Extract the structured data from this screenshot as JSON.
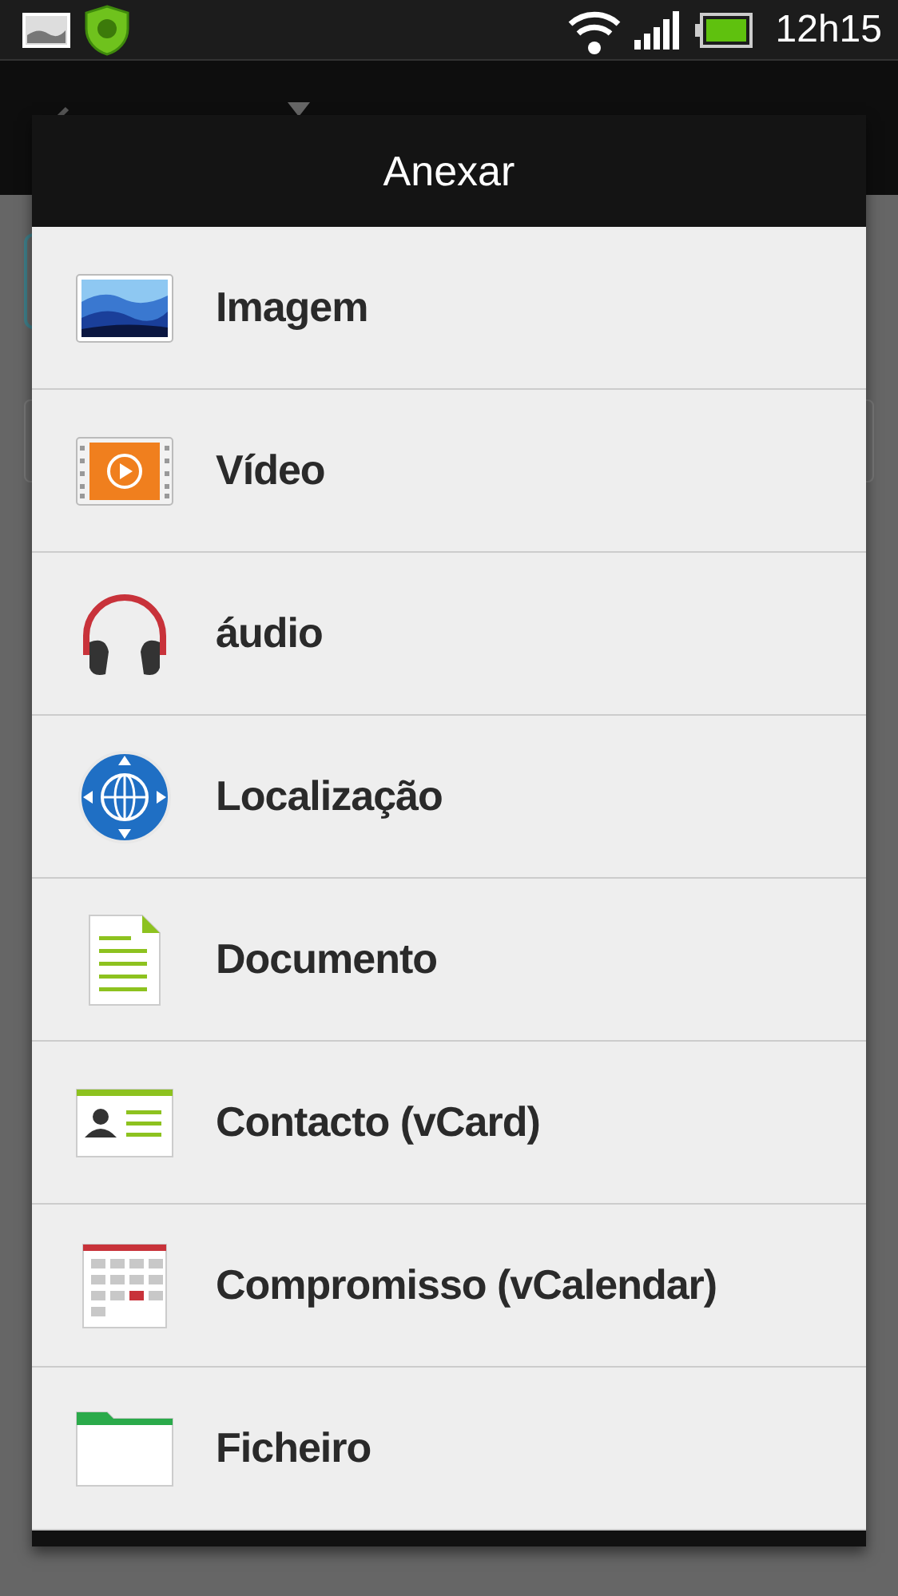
{
  "status_bar": {
    "time": "12h15"
  },
  "dialog": {
    "title": "Anexar",
    "items": [
      {
        "kind": "image",
        "label": "Imagem"
      },
      {
        "kind": "video",
        "label": "Vídeo"
      },
      {
        "kind": "audio",
        "label": "áudio"
      },
      {
        "kind": "location",
        "label": "Localização"
      },
      {
        "kind": "document",
        "label": "Documento"
      },
      {
        "kind": "contact",
        "label": "Contacto (vCard)"
      },
      {
        "kind": "calendar",
        "label": "Compromisso (vCalendar)"
      },
      {
        "kind": "file",
        "label": "Ficheiro"
      }
    ]
  }
}
